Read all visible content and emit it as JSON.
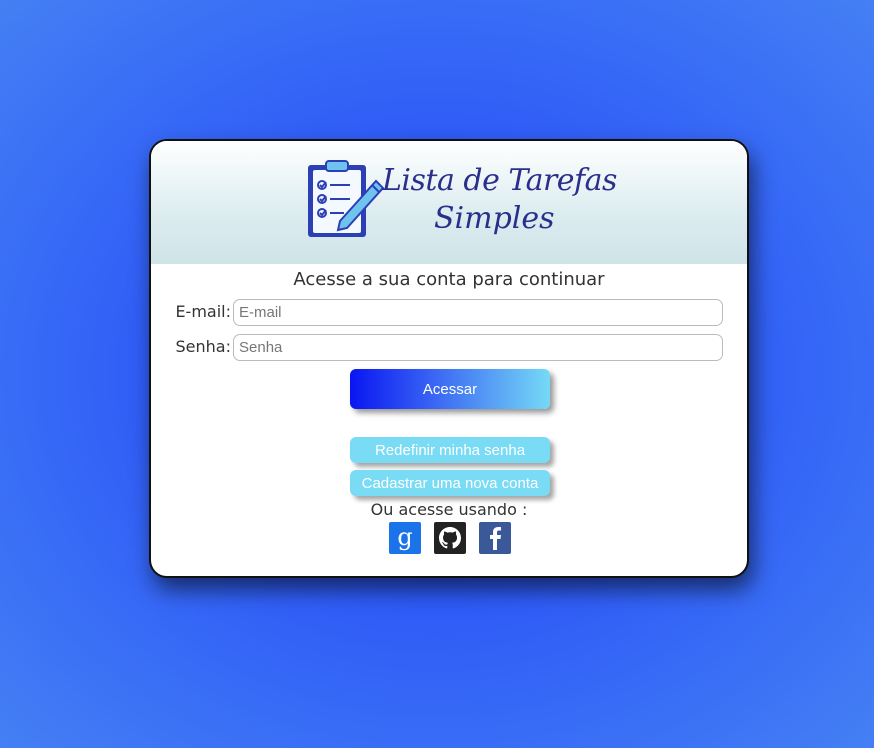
{
  "header": {
    "logo_line1": "Lista de Tarefas",
    "logo_line2": "Simples"
  },
  "form": {
    "subtitle": "Acesse a sua conta para continuar",
    "email_label": "E-mail:",
    "email_placeholder": "E-mail",
    "email_value": "",
    "senha_label": "Senha:",
    "senha_placeholder": "Senha",
    "senha_value": ""
  },
  "buttons": {
    "acessar": "Acessar",
    "redefinir": "Redefinir minha senha",
    "cadastrar": "Cadastrar uma nova conta"
  },
  "social": {
    "label": "Ou acesse usando :",
    "providers": [
      {
        "name": "google-icon",
        "color": "#1a73e8"
      },
      {
        "name": "github-icon",
        "color": "#222222"
      },
      {
        "name": "facebook-icon",
        "color": "#3b5998"
      }
    ]
  },
  "colors": {
    "background": "#2f5cf7",
    "primary_gradient_start": "#0a16f2",
    "primary_gradient_end": "#75d9f6",
    "secondary_button": "#79dbf4",
    "logo_text": "#2a2f8c"
  }
}
